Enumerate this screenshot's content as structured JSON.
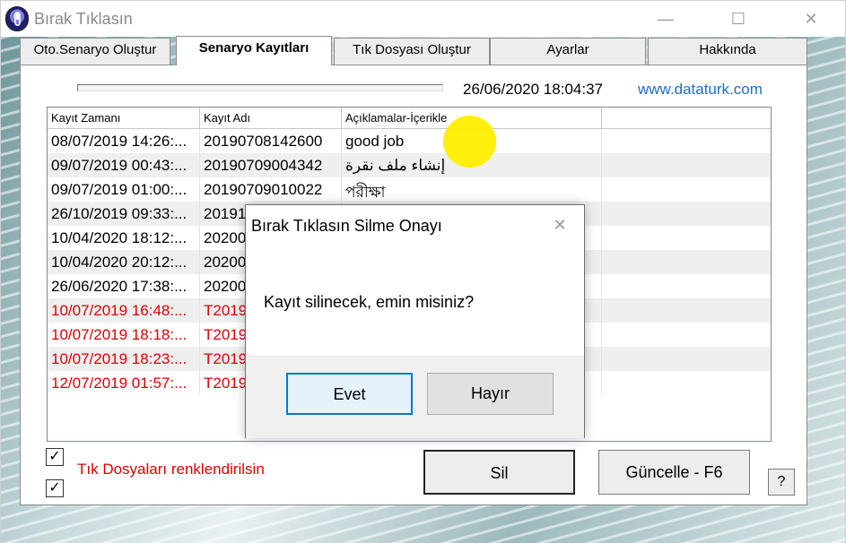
{
  "window": {
    "title": "Bırak Tıklasın",
    "minimize": "—",
    "maximize": "☐",
    "close": "✕"
  },
  "tabs": [
    {
      "label": "Oto.Senaryo Oluştur",
      "active": false
    },
    {
      "label": "Senaryo Kayıtları",
      "active": true
    },
    {
      "label": "Tık Dosyası Oluştur",
      "active": false
    },
    {
      "label": "Ayarlar",
      "active": false
    },
    {
      "label": "Hakkında",
      "active": false
    }
  ],
  "header": {
    "datetime": "26/06/2020 18:04:37",
    "website": "www.dataturk.com"
  },
  "list": {
    "columns": [
      "Kayıt Zamanı",
      "Kayıt Adı",
      "Açıklamalar-İçerikle"
    ],
    "rows": [
      {
        "time": "08/07/2019 14:26:...",
        "name": "20190708142600",
        "desc": "good job",
        "red": false
      },
      {
        "time": "09/07/2019 00:43:...",
        "name": "20190709004342",
        "desc": "إنشاء ملف نقرة",
        "red": false
      },
      {
        "time": "09/07/2019 01:00:...",
        "name": "20190709010022",
        "desc": "পরীক্ষা",
        "red": false
      },
      {
        "time": "26/10/2019 09:33:...",
        "name": "20191",
        "desc": "",
        "red": false
      },
      {
        "time": "10/04/2020 18:12:...",
        "name": "20200",
        "desc": "",
        "red": false
      },
      {
        "time": "10/04/2020 20:12:...",
        "name": "20200",
        "desc": "",
        "red": false
      },
      {
        "time": "26/06/2020 17:38:...",
        "name": "20200",
        "desc": "",
        "red": false
      },
      {
        "time": "10/07/2019 16:48:...",
        "name": "T2019",
        "desc": "",
        "red": true
      },
      {
        "time": "10/07/2019 18:18:...",
        "name": "T2019",
        "desc": "",
        "red": true
      },
      {
        "time": "10/07/2019 18:23:...",
        "name": "T2019",
        "desc": "",
        "red": true
      },
      {
        "time": "12/07/2019 01:57:...",
        "name": "T2019",
        "desc": "",
        "red": true
      }
    ]
  },
  "options": {
    "colorize_label": "Tık Dosyaları renklendirilsin",
    "check1": "✓",
    "check2": "✓"
  },
  "buttons": {
    "delete": "Sil",
    "refresh": "Güncelle - F6",
    "help": "?"
  },
  "dialog": {
    "title": "Bırak Tıklasın Silme Onayı",
    "close": "✕",
    "message": "Kayıt silinecek, emin misiniz?",
    "yes": "Evet",
    "no": "Hayır"
  },
  "colors": {
    "accent_link": "#1e6fc8",
    "red_text": "#e00000",
    "cursor_highlight": "#ffee00"
  }
}
